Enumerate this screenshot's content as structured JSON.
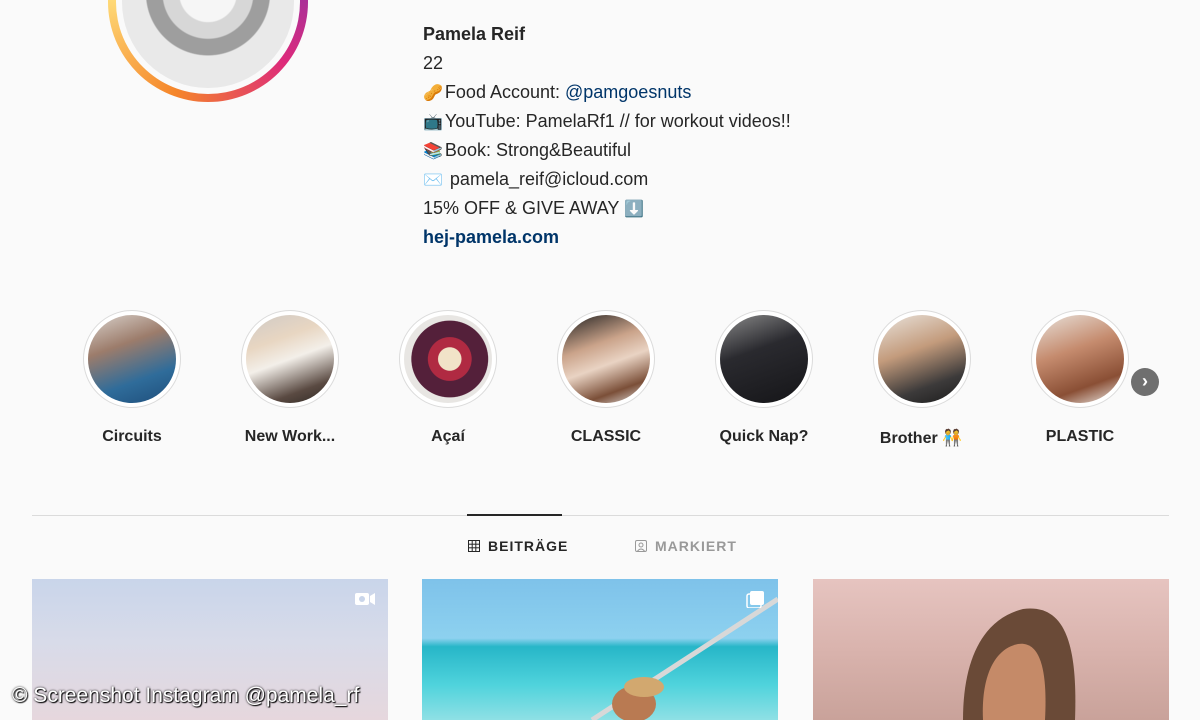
{
  "profile": {
    "name": "Pamela Reif",
    "age": "22",
    "bio_lines": [
      {
        "emoji": "🥜",
        "prefix": "Food Account: ",
        "handle": "@pamgoesnuts"
      },
      {
        "emoji": "📺",
        "text": "YouTube: PamelaRf1 // for workout videos!!"
      },
      {
        "emoji": "📚",
        "text": "Book: Strong&Beautiful"
      },
      {
        "emoji": "✉️",
        "text": " pamela_reif@icloud.com"
      },
      {
        "text": "15% OFF & GIVE AWAY ",
        "emoji_after": "⬇️"
      }
    ],
    "link": "hej-pamela.com"
  },
  "highlights": [
    {
      "label": "Circuits"
    },
    {
      "label": "New Work..."
    },
    {
      "label": "Açaí"
    },
    {
      "label": "CLASSIC"
    },
    {
      "label": "Quick Nap?"
    },
    {
      "label": "Brother",
      "emoji": "🧑‍🤝‍🧑"
    },
    {
      "label": "PLASTIC"
    }
  ],
  "tabs": [
    {
      "label": "BEITRÄGE",
      "active": true,
      "icon": "grid-icon"
    },
    {
      "label": "MARKIERT",
      "active": false,
      "icon": "tagged-icon"
    }
  ],
  "posts": [
    {
      "type": "video",
      "icon": "video-icon"
    },
    {
      "type": "carousel",
      "icon": "carousel-icon"
    },
    {
      "type": "image"
    }
  ],
  "watermark": "© Screenshot Instagram @pamela_rf",
  "colors": {
    "link": "#003569",
    "accent_gradient": [
      "#f58529",
      "#dd2a7b",
      "#8134af"
    ]
  }
}
